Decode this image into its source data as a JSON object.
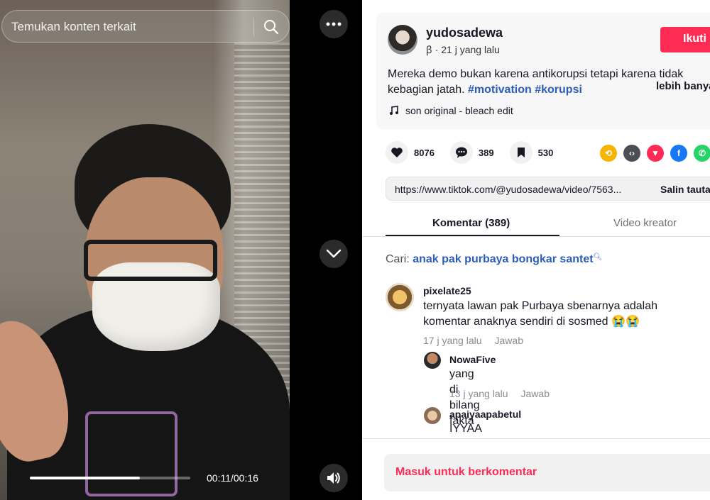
{
  "video": {
    "search_placeholder": "Temukan konten terkait",
    "progress": 0.6875,
    "time": "00:11/00:16"
  },
  "post": {
    "username": "yudosadewa",
    "subline": "ꞵ · 21 j yang lalu",
    "follow_label": "Ikuti",
    "desc_text": "Mereka demo bukan karena antikorupsi tetapi karena tidak kebagian jatah. ",
    "hashtags": [
      "#motivation",
      "#korupsi"
    ],
    "more_label": "lebih banyak",
    "music": "son original - bleach edit"
  },
  "actions": {
    "likes": "8076",
    "comments": "389",
    "saves": "530"
  },
  "share_icons": [
    {
      "name": "repost-icon",
      "color": "#f5b400"
    },
    {
      "name": "embed-icon",
      "color": "#4d4f57"
    },
    {
      "name": "send-icon",
      "color": "#fe2c55"
    },
    {
      "name": "facebook-icon",
      "color": "#1877f2"
    },
    {
      "name": "whatsapp-icon",
      "color": "#25d366"
    }
  ],
  "link": {
    "url": "https://www.tiktok.com/@yudosadewa/video/7563...",
    "copy_label": "Salin tautan"
  },
  "tabs": {
    "comments": "Komentar (389)",
    "creator_videos": "Video kreator"
  },
  "search_suggest": {
    "prefix": "Cari:",
    "query": "anak pak purbaya bongkar santet"
  },
  "comments": [
    {
      "user": "pixelate25",
      "text": "ternyata lawan pak Purbaya sbenarnya adalah komentar anaknya sendiri di sosmed 😭😭",
      "time": "17 j yang lalu",
      "reply": "Jawab"
    },
    {
      "user": "NowaFive",
      "text": "yang di bilang fakta",
      "time": "13 j yang lalu",
      "reply": "Jawab"
    },
    {
      "user": "apaiyaapabetul",
      "text": "IYYAA LAGI 😢"
    }
  ],
  "login_comment": "Masuk untuk berkomentar"
}
